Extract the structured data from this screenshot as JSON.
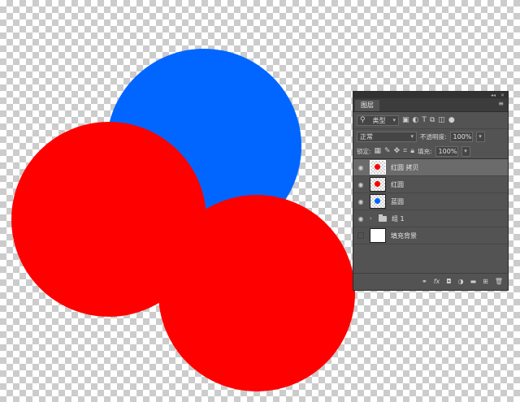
{
  "panel": {
    "title": "图层",
    "filter": {
      "label": "类型"
    },
    "blend": {
      "mode": "正常",
      "opacity_label": "不透明度:",
      "opacity_value": "100%"
    },
    "lock": {
      "label": "锁定:",
      "fill_label": "填充:",
      "fill_value": "100%"
    },
    "layers": [
      {
        "name": "红圆 拷贝",
        "type": "shape",
        "color": "#ff0000",
        "selected": true
      },
      {
        "name": "红圆",
        "type": "shape",
        "color": "#ff0000",
        "selected": false
      },
      {
        "name": "蓝圆",
        "type": "shape",
        "color": "#0066ff",
        "selected": false
      },
      {
        "name": "组 1",
        "type": "group",
        "selected": false
      },
      {
        "name": "填充背景",
        "type": "fill",
        "color": "#ffffff",
        "visible": false
      }
    ]
  },
  "canvas": {
    "colors": {
      "blue": "#0066ff",
      "red": "#ff0000"
    }
  },
  "icons": {
    "filter_icons": [
      "image-filter-icon",
      "adjustment-filter-icon",
      "type-filter-icon",
      "shape-filter-icon",
      "smart-object-filter-icon",
      "filter-toggle-icon"
    ],
    "lock_icons": [
      "lock-transparent-icon",
      "lock-image-icon",
      "lock-position-icon",
      "lock-artboard-icon",
      "lock-all-icon"
    ],
    "bottom_icons": [
      "link-layers-icon",
      "fx-icon",
      "add-mask-icon",
      "adjustment-layer-icon",
      "new-group-icon",
      "new-layer-icon",
      "delete-layer-icon"
    ]
  }
}
